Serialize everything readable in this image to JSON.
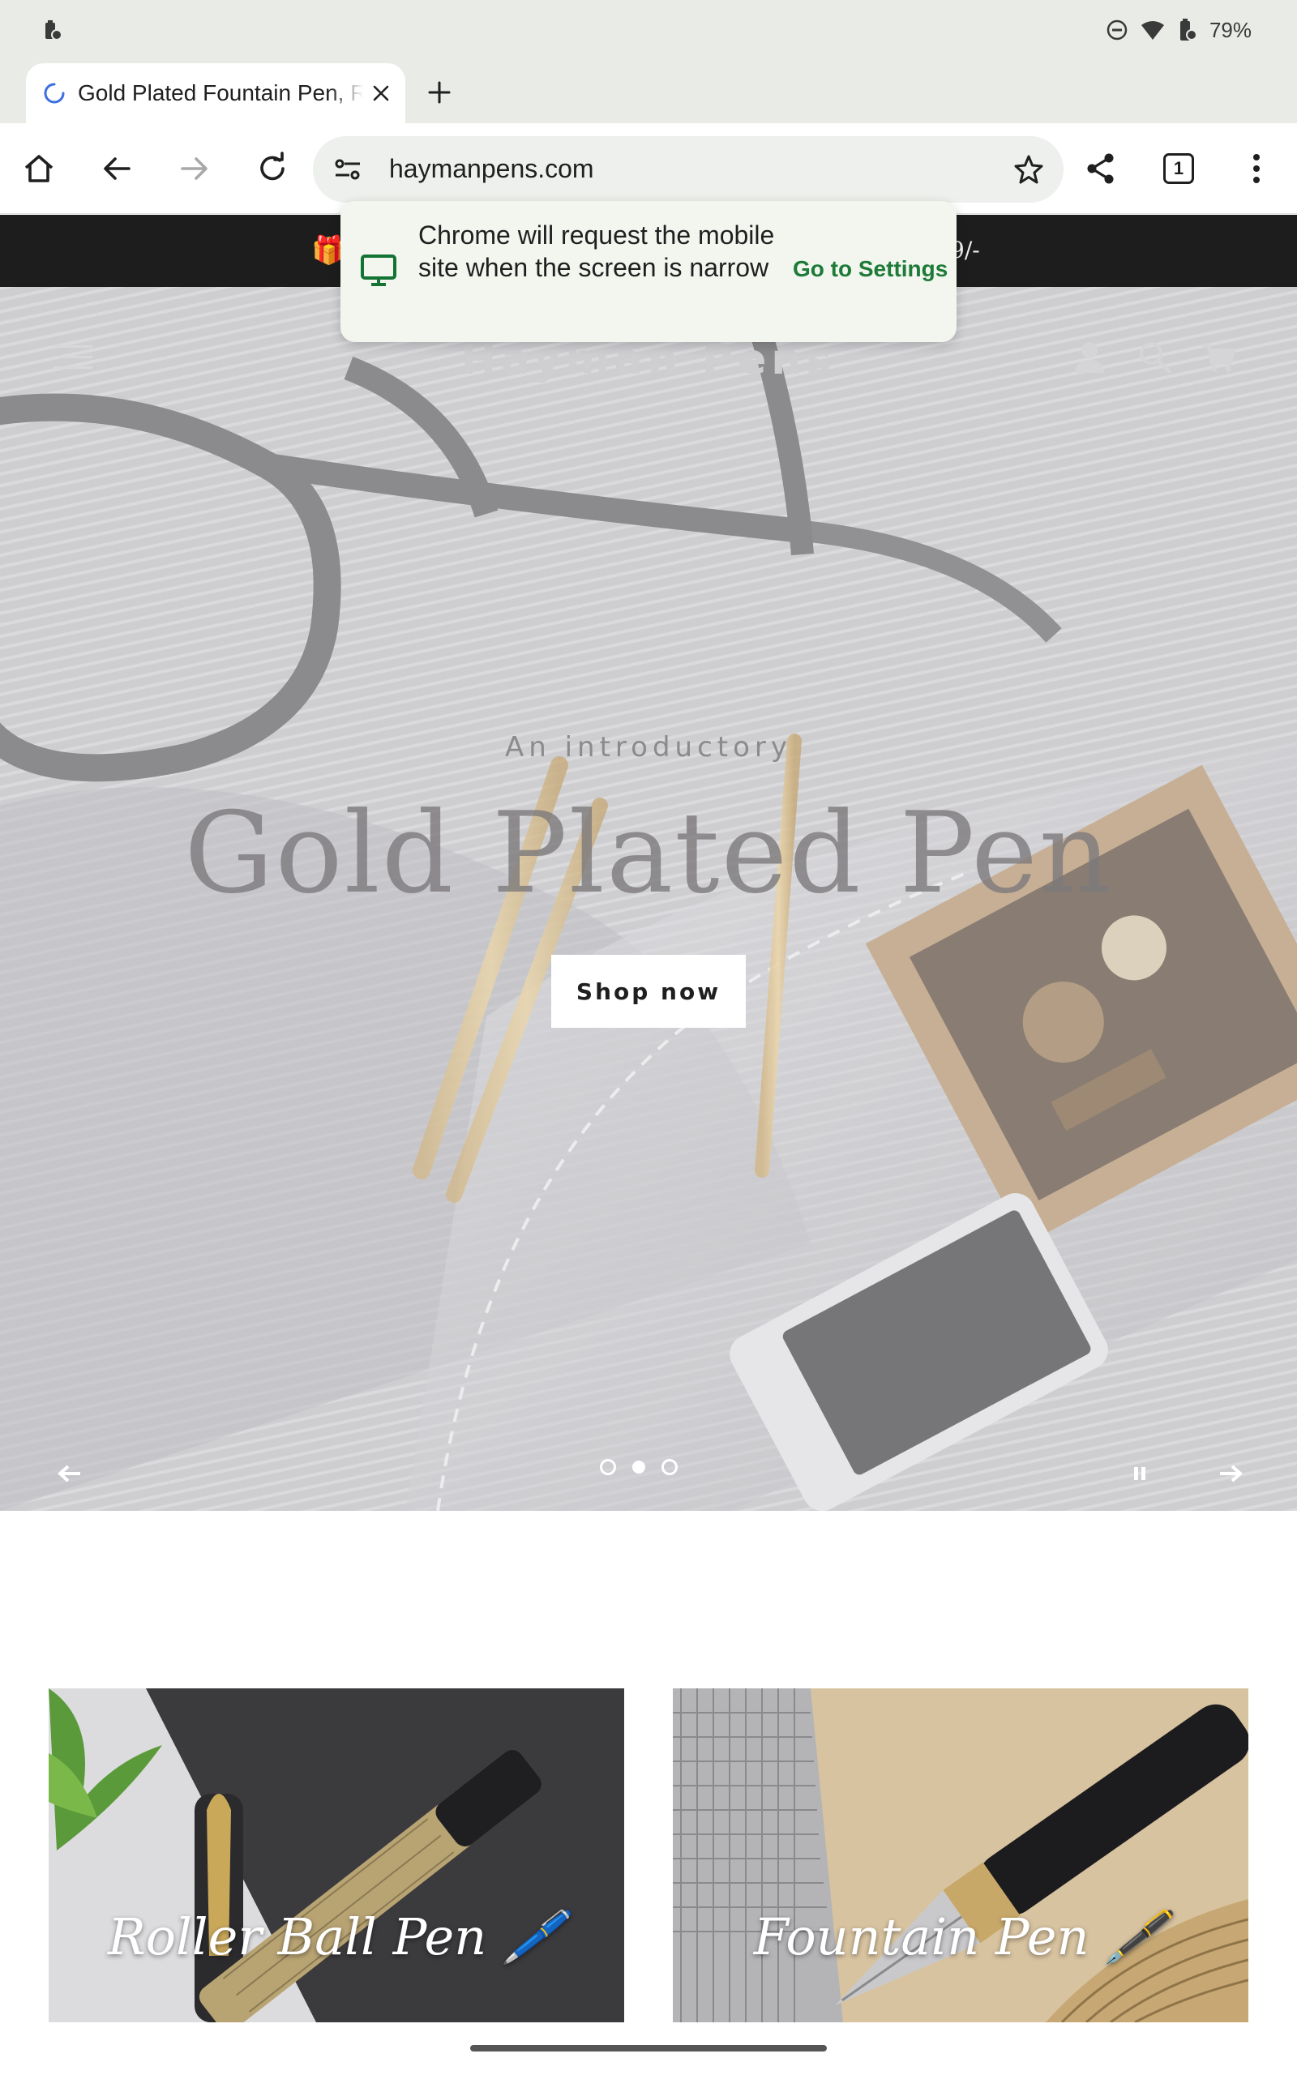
{
  "status_bar": {
    "battery": "79%"
  },
  "browser": {
    "tab": {
      "title": "Gold Plated Fountain Pen, R"
    },
    "url": "haymanpens.com",
    "tab_count": "1",
    "popup": {
      "message": "Chrome will request the mobile site when the screen is narrow",
      "action": "Go to Settings"
    }
  },
  "announcement": {
    "icon": "gift-icon",
    "text": "9/-"
  },
  "site": {
    "brand": "Hayman Pens",
    "hero": {
      "kicker": "An introductory",
      "title": "Gold Plated Pen",
      "button": "Shop now",
      "slide_count": 3,
      "active_slide": 2
    },
    "collections": [
      {
        "label": "Roller Ball Pen 🖊️"
      },
      {
        "label": "Fountain Pen 🖋️"
      }
    ]
  },
  "colors": {
    "accent_link": "#1e7a38",
    "chrome_bg": "#e8ebe6",
    "announcement_bg": "#1d1d1d"
  }
}
